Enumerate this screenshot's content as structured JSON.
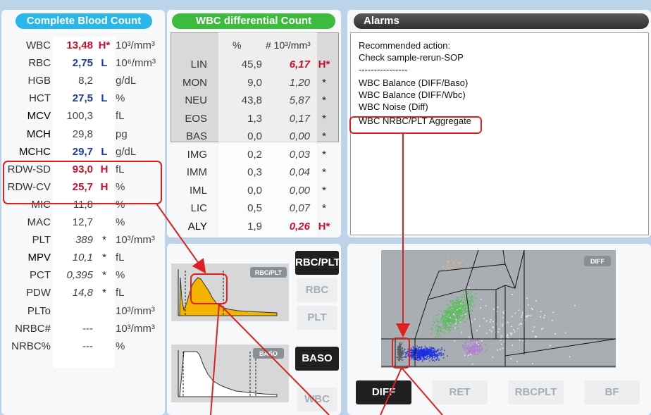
{
  "cbc": {
    "title": "Complete Blood Count",
    "rows": [
      {
        "name": "WBC",
        "value": "13,48",
        "flag": "H*",
        "unit": "10³/mm³"
      },
      {
        "name": "RBC",
        "value": "2,75",
        "flag": "L",
        "unit": "10⁶/mm³"
      },
      {
        "name": "HGB",
        "value": "8,2",
        "flag": "",
        "unit": "g/dL"
      },
      {
        "name": "HCT",
        "value": "27,5",
        "flag": "L",
        "unit": "%"
      },
      {
        "name": "MCV",
        "value": "100,3",
        "flag": "",
        "unit": "fL"
      },
      {
        "name": "MCH",
        "value": "29,8",
        "flag": "",
        "unit": "pg"
      },
      {
        "name": "MCHC",
        "value": "29,7",
        "flag": "L",
        "unit": "g/dL"
      },
      {
        "name": "RDW-SD",
        "value": "93,0",
        "flag": "H",
        "unit": "fL"
      },
      {
        "name": "RDW-CV",
        "value": "25,7",
        "flag": "H",
        "unit": "%"
      },
      {
        "name": "MIC",
        "value": "11,8",
        "flag": "",
        "unit": "%"
      },
      {
        "name": "MAC",
        "value": "12,7",
        "flag": "",
        "unit": "%"
      },
      {
        "name": "PLT",
        "value": "389",
        "flag": "*",
        "unit": "10³/mm³"
      },
      {
        "name": "MPV",
        "value": "10,1",
        "flag": "*",
        "unit": "fL"
      },
      {
        "name": "PCT",
        "value": "0,395",
        "flag": "*",
        "unit": "%"
      },
      {
        "name": "PDW",
        "value": "14,8",
        "flag": "*",
        "unit": "fL"
      },
      {
        "name": "PLTo",
        "value": "",
        "flag": "",
        "unit": "10³/mm³"
      },
      {
        "name": "NRBC#",
        "value": "---",
        "flag": "",
        "unit": "10³/mm³"
      },
      {
        "name": "NRBC%",
        "value": "---",
        "flag": "",
        "unit": "%"
      }
    ]
  },
  "wbc_diff": {
    "title": "WBC differential Count",
    "col_pct": "%",
    "col_abs": "# 10³/mm³",
    "rows": [
      {
        "name": "LIN",
        "pct": "45,9",
        "abs": "6,17",
        "flag": "H*"
      },
      {
        "name": "MON",
        "pct": "9,0",
        "abs": "1,20",
        "flag": "*"
      },
      {
        "name": "NEU",
        "pct": "43,8",
        "abs": "5,87",
        "flag": "*"
      },
      {
        "name": "EOS",
        "pct": "1,3",
        "abs": "0,17",
        "flag": "*"
      },
      {
        "name": "BAS",
        "pct": "0,0",
        "abs": "0,00",
        "flag": "*"
      },
      {
        "name": "IMG",
        "pct": "0,2",
        "abs": "0,03",
        "flag": "*"
      },
      {
        "name": "IMM",
        "pct": "0,3",
        "abs": "0,04",
        "flag": "*"
      },
      {
        "name": "IML",
        "pct": "0,0",
        "abs": "0,00",
        "flag": "*"
      },
      {
        "name": "LIC",
        "pct": "0,5",
        "abs": "0,07",
        "flag": "*"
      },
      {
        "name": "ALY",
        "pct": "1,9",
        "abs": "0,26",
        "flag": "H*"
      }
    ]
  },
  "alarms": {
    "title": "Alarms",
    "lines": [
      "Recommended action:",
      "Check sample-rerun-SOP",
      "----------------",
      "WBC Balance (DIFF/Baso)",
      "WBC Balance (DIFF/Wbc)",
      "WBC Noise (Diff)",
      "WBC NRBC/PLT Aggregate"
    ]
  },
  "histograms": {
    "rbc_plt_tag": "RBC/PLT",
    "baso_tag": "BASO",
    "buttons": {
      "rbc_plt": "RBC/PLT",
      "rbc": "RBC",
      "plt": "PLT",
      "baso": "BASO",
      "wbc": "WBC"
    }
  },
  "scatter": {
    "tag": "DIFF",
    "tabs": {
      "diff": "DIFF",
      "ret": "RET",
      "rbcplt": "RBCPLT",
      "bf": "BF"
    }
  },
  "colors": {
    "header_blue": "#29b7ea",
    "header_green": "#3dbb3d",
    "header_dark": "#4a4a4a",
    "flag_red": "#c8102e",
    "flag_blue": "#1f3a9e",
    "annotation_red": "#e02020",
    "histogram_fill": "#f2b400",
    "scatter_green": "#4cc24c",
    "scatter_blue": "#1a2ee0",
    "scatter_purple": "#b07ad8"
  }
}
